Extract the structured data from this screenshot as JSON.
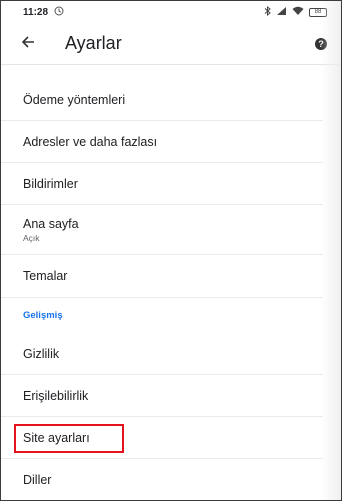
{
  "status_bar": {
    "time": "11:28",
    "notification_icon": "clock-icon",
    "right_icons": [
      "bluetooth-icon",
      "signal-icon",
      "wifi-icon",
      "battery-icon"
    ],
    "battery_level": "88"
  },
  "app_bar": {
    "back_icon": "arrow-back-icon",
    "title": "Ayarlar",
    "help_icon": "help-icon"
  },
  "settings": {
    "items": [
      {
        "label": "Ödeme yöntemleri"
      },
      {
        "label": "Adresler ve daha fazlası"
      },
      {
        "label": "Bildirimler"
      },
      {
        "label": "Ana sayfa",
        "sub": "Açık"
      },
      {
        "label": "Temalar"
      },
      {
        "section": "Gelişmiş"
      },
      {
        "label": "Gizlilik"
      },
      {
        "label": "Erişilebilirlik"
      },
      {
        "label": "Site ayarları"
      },
      {
        "label": "Diller"
      }
    ]
  },
  "highlight_color": "#e5131b",
  "section_color": "#1a73e8"
}
